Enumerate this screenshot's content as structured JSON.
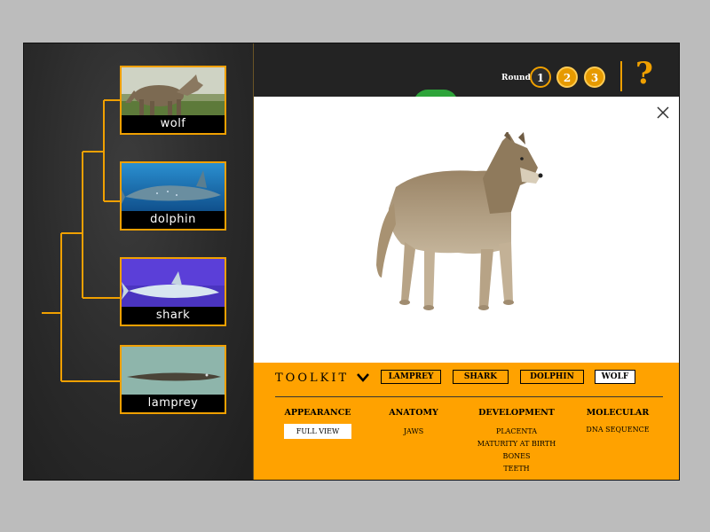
{
  "tree": {
    "cards": [
      {
        "label": "wolf"
      },
      {
        "label": "dolphin"
      },
      {
        "label": "shark"
      },
      {
        "label": "lamprey"
      }
    ],
    "line_color": "#f0a000"
  },
  "header": {
    "round_label": "Round",
    "rounds": [
      "1",
      "2",
      "3"
    ],
    "help_label": "?"
  },
  "modal": {
    "close_icon": "close-icon",
    "image_icon": "wolf-photo"
  },
  "toolkit": {
    "title": "TOOLKIT",
    "chevron_icon": "chevron-down-icon",
    "animals": [
      {
        "label": "LAMPREY",
        "active": false
      },
      {
        "label": "SHARK",
        "active": false
      },
      {
        "label": "DOLPHIN",
        "active": false
      },
      {
        "label": "WOLF",
        "active": true
      }
    ],
    "categories": [
      {
        "heading": "APPEARANCE",
        "items": [
          "FULL VIEW"
        ]
      },
      {
        "heading": "ANATOMY",
        "items": [
          "JAWS"
        ]
      },
      {
        "heading": "DEVELOPMENT",
        "items": [
          "PLACENTA",
          "MATURITY AT BIRTH",
          "BONES",
          "TEETH"
        ]
      },
      {
        "heading": "MOLECULAR",
        "items": [
          "DNA SEQUENCE"
        ]
      }
    ]
  },
  "colors": {
    "accent": "#f0a000",
    "toolkit_bg": "#ffa200",
    "dark_bg": "#232323",
    "green": "#2ea43a"
  }
}
